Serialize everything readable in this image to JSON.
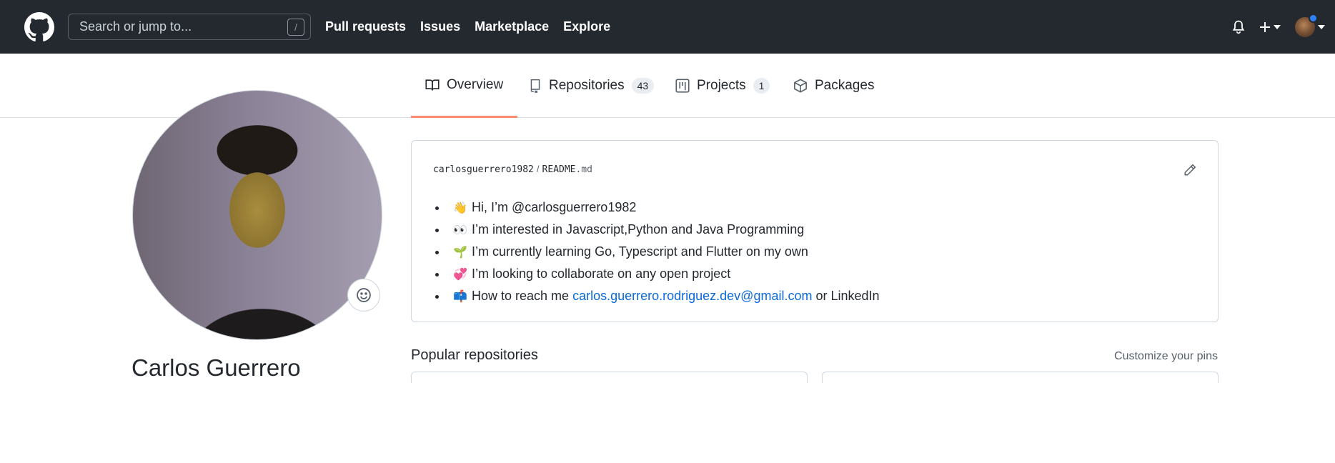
{
  "header": {
    "search_placeholder": "Search or jump to...",
    "search_shortcut": "/",
    "nav": [
      "Pull requests",
      "Issues",
      "Marketplace",
      "Explore"
    ],
    "icons": [
      "github-logo-icon",
      "bell-icon",
      "plus-icon",
      "avatar"
    ]
  },
  "tabs": [
    {
      "label": "Overview",
      "icon": "book-icon",
      "active": true
    },
    {
      "label": "Repositories",
      "count": "43",
      "icon": "repo-icon"
    },
    {
      "label": "Projects",
      "count": "1",
      "icon": "project-icon"
    },
    {
      "label": "Packages",
      "icon": "package-icon"
    }
  ],
  "profile": {
    "name": "Carlos Guerrero"
  },
  "readme": {
    "owner": "carlosguerrero1982",
    "separator": "/",
    "file_base": "README",
    "file_ext": ".md",
    "items": [
      {
        "emoji": "👋",
        "text": "Hi, I’m @carlosguerrero1982"
      },
      {
        "emoji": "👀",
        "text": "I’m interested in Javascript,Python and Java Programming"
      },
      {
        "emoji": "🌱",
        "text": "I’m currently learning Go, Typescript and Flutter on my own"
      },
      {
        "emoji": "💞️",
        "text": "I’m looking to collaborate on any open project"
      },
      {
        "emoji": "📫",
        "text_before": "How to reach me ",
        "link": "carlos.guerrero.rodriguez.dev@gmail.com",
        "text_after": " or LinkedIn"
      }
    ]
  },
  "popular": {
    "title": "Popular repositories",
    "customize": "Customize your pins"
  },
  "colors": {
    "header_bg": "#24292f",
    "link": "#0969da",
    "tab_active_underline": "#fd8c73",
    "notification_dot": "#2f81f7"
  }
}
